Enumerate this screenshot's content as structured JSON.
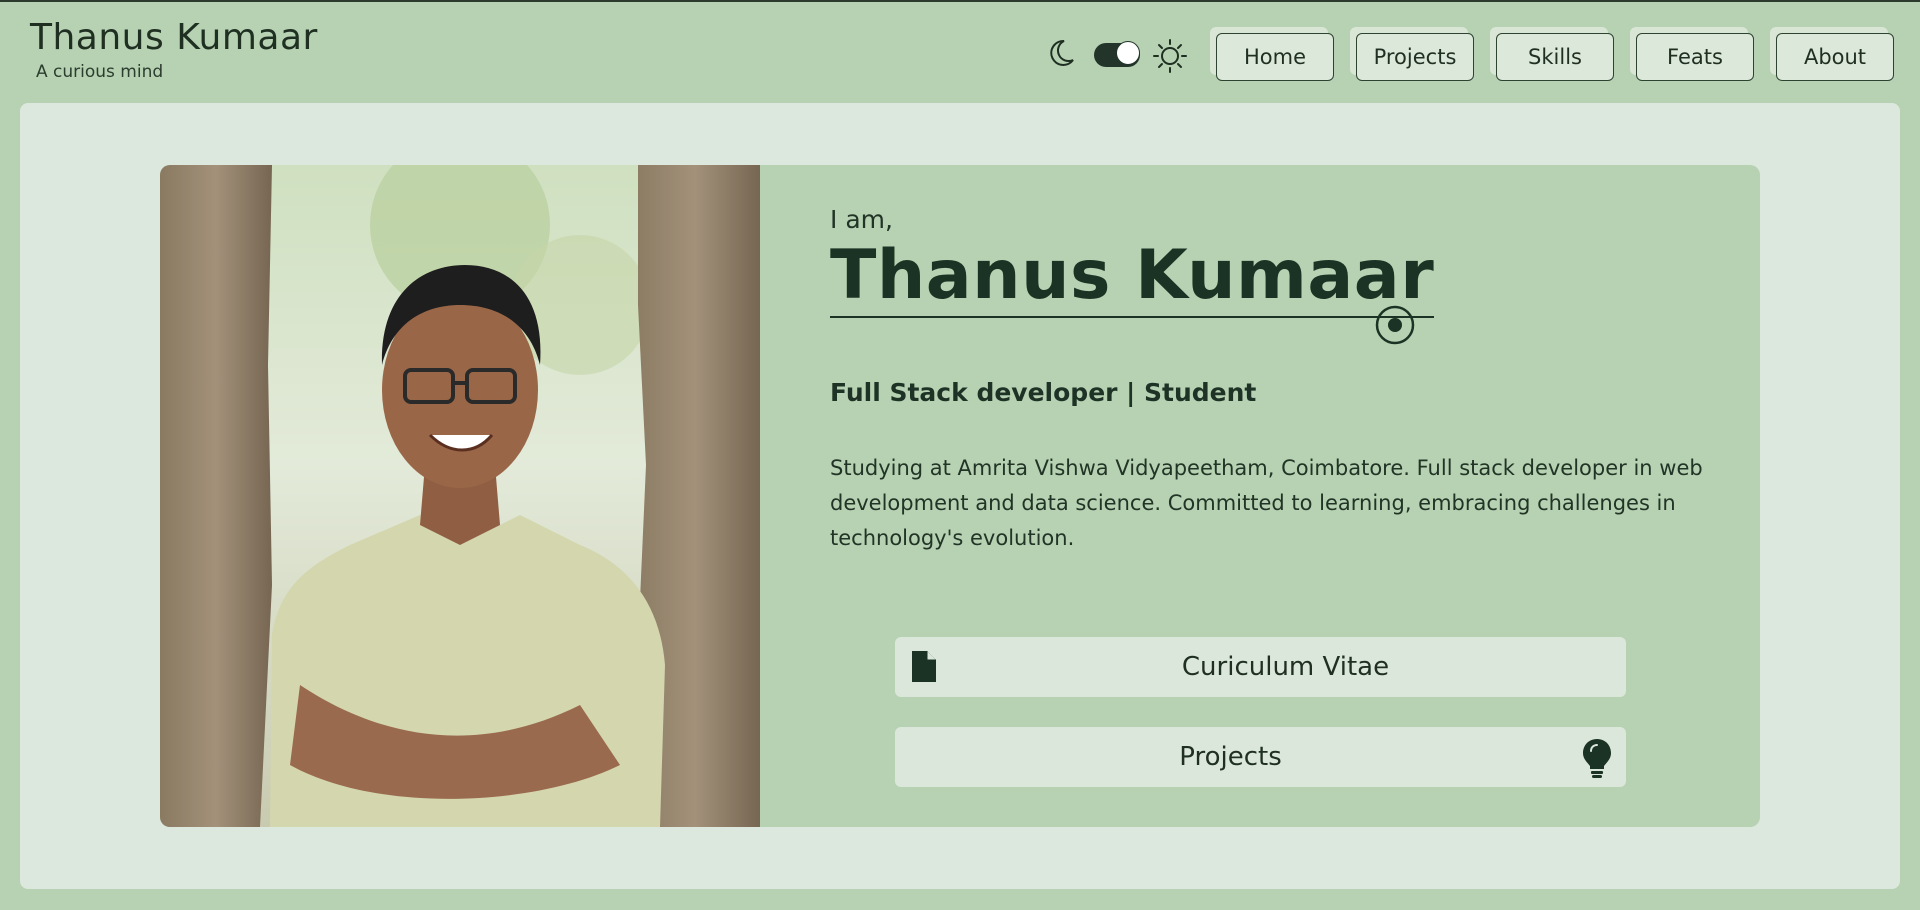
{
  "header": {
    "title": "Thanus Kumaar",
    "subtitle": "A curious mind",
    "theme_toggle": {
      "state": "light",
      "left_icon": "moon-icon",
      "right_icon": "sun-icon"
    },
    "nav": [
      {
        "label": "Home"
      },
      {
        "label": "Projects"
      },
      {
        "label": "Skills"
      },
      {
        "label": "Feats"
      },
      {
        "label": "About"
      }
    ]
  },
  "hero": {
    "greeting": "I am,",
    "name": "Thanus Kumaar",
    "role": "Full Stack developer | Student",
    "description": "Studying at Amrita Vishwa Vidyapeetham, Coimbatore. Full stack developer in web development and data science. Committed to learning, embracing challenges in technology's evolution.",
    "photo": "portrait-photo",
    "buttons": {
      "cv_label": "Curiculum Vitae",
      "cv_icon": "file-icon",
      "projects_label": "Projects",
      "projects_icon": "lightbulb-icon"
    }
  },
  "colors": {
    "background": "#b6d2b2",
    "panel": "#dce8dd",
    "text": "#1b3324"
  }
}
